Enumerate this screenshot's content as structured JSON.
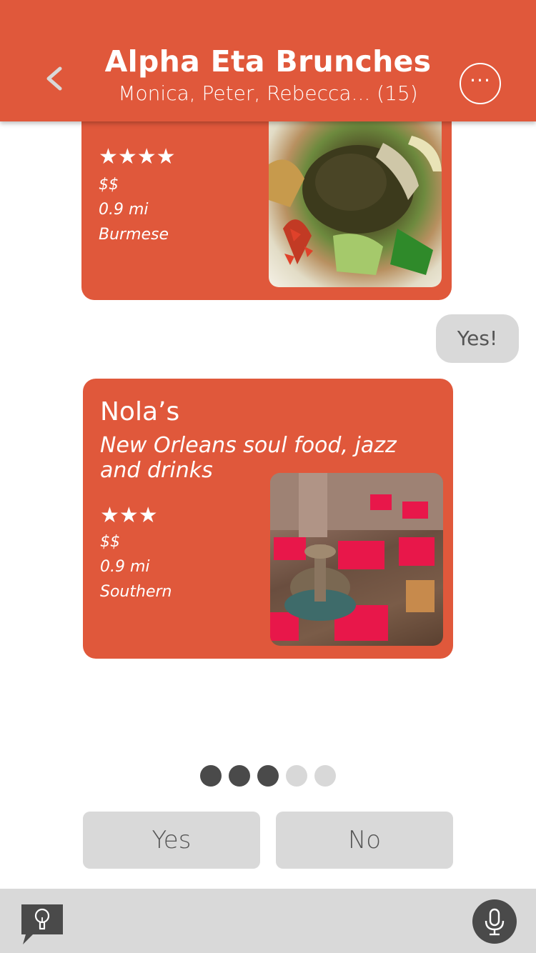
{
  "header": {
    "title": "Alpha Eta Brunches",
    "subtitle": "Monica, Peter, Rebecca... (15)",
    "more_label": "···"
  },
  "cards": [
    {
      "stars": "★★★★",
      "price": "$$",
      "distance": "0.9 mi",
      "cuisine": "Burmese"
    },
    {
      "name": "Nola’s",
      "description": "New Orleans soul food, jazz and drinks",
      "stars": "★★★",
      "price": "$$",
      "distance": "0.9 mi",
      "cuisine": "Southern"
    }
  ],
  "reply_bubble": "Yes!",
  "pager": {
    "total": 5,
    "current": 3
  },
  "choices": {
    "yes": "Yes",
    "no": "No"
  },
  "colors": {
    "accent": "#e0583b",
    "gray": "#d9d9d9",
    "dark": "#4a4a4a"
  },
  "icons": {
    "back": "chevron-left-icon",
    "more": "ellipsis-icon",
    "tip": "lightbulb-icon",
    "mic": "microphone-icon"
  }
}
